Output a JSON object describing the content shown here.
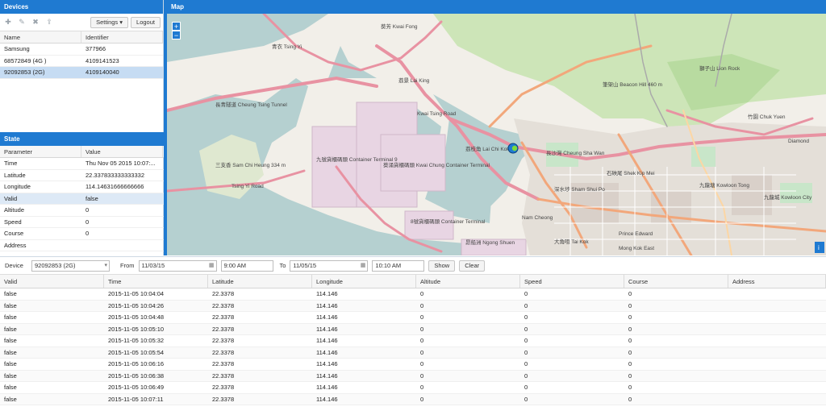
{
  "devices_panel": {
    "title": "Devices",
    "settings_label": "Settings",
    "logout_label": "Logout",
    "columns": [
      "Name",
      "Identifier"
    ],
    "rows": [
      {
        "name": "Samsung",
        "identifier": "377966"
      },
      {
        "name": "68572849 (4G )",
        "identifier": "4109141523"
      },
      {
        "name": "92092853 (2G)",
        "identifier": "4109140040"
      }
    ]
  },
  "state_panel": {
    "title": "State",
    "columns": [
      "Parameter",
      "Value"
    ],
    "rows": [
      {
        "param": "Time",
        "value": "Thu Nov 05 2015 10:07:..."
      },
      {
        "param": "Latitude",
        "value": "22.337833333333332"
      },
      {
        "param": "Longitude",
        "value": "114.14631666666666"
      },
      {
        "param": "Valid",
        "value": "false"
      },
      {
        "param": "Altitude",
        "value": "0"
      },
      {
        "param": "Speed",
        "value": "0"
      },
      {
        "param": "Course",
        "value": "0"
      },
      {
        "param": "Address",
        "value": ""
      }
    ]
  },
  "map": {
    "title": "Map",
    "zoom_in": "+",
    "zoom_out": "−",
    "labels": {
      "container_terminal_1": "九號貨櫃碼頭 Container Terminal 9",
      "container_terminal_2": "葵涌貨櫃碼頭 Kwai Chung Container Terminal",
      "container_terminal_3": "8號貨櫃碼頭 Container Terminal",
      "lai_king": "荔景 Lai King",
      "kwai_fong": "葵芳 Kwai Fong",
      "tsing_yi": "青衣 Tsing Yi",
      "lai_chi_kok": "荔枝角 Lai Chi Kok",
      "cheung_sha_wan": "長沙灣 Cheung Sha Wan",
      "sham_shui_po": "深水埗 Sham Shui Po",
      "shek_kip_mei": "石硤尾 Shek Kip Mei",
      "kowloon_tong": "九龍塘 Kowloon Tong",
      "kowloon_city": "九龍城 Kowloon City",
      "nam_cheong": "Nam Cheong",
      "tai_kok_tsui": "大角咀 Tai Kok",
      "prince_edward": "Prince Edward",
      "mong_kok_east": "Mong Kok East",
      "lion_rock": "獅子山 Lion Rock",
      "beacon_hill": "筆架山 Beacon Hill 460 m",
      "sam_chi_heung": "三支香 Sam Chi Heung 334 m",
      "chuk_yuen": "竹園 Chuk Yuen",
      "tsing_yi_road": "Tsing Yi Road",
      "cheung_tsing_tunnel": "長青隧道 Cheung Tsing Tunnel",
      "diamond": "Diamond",
      "ngong_shuen": "昂船洲 Ngong Shuen",
      "kwai_tsing_road": "Kwai Tsing Road"
    }
  },
  "filter_bar": {
    "device_label": "Device",
    "device_value": "92092853 (2G)",
    "from_label": "From",
    "from_date": "11/03/15",
    "from_time": "9:00 AM",
    "to_label": "To",
    "to_date": "11/05/15",
    "to_time": "10:10 AM",
    "show_label": "Show",
    "clear_label": "Clear"
  },
  "history": {
    "columns": [
      "Valid",
      "Time",
      "Latitude",
      "Longitude",
      "Altitude",
      "Speed",
      "Course",
      "Address"
    ],
    "rows": [
      [
        "false",
        "2015-11-05 10:04:04",
        "22.3378",
        "114.146",
        "0",
        "0",
        "0",
        ""
      ],
      [
        "false",
        "2015-11-05 10:04:26",
        "22.3378",
        "114.146",
        "0",
        "0",
        "0",
        ""
      ],
      [
        "false",
        "2015-11-05 10:04:48",
        "22.3378",
        "114.146",
        "0",
        "0",
        "0",
        ""
      ],
      [
        "false",
        "2015-11-05 10:05:10",
        "22.3378",
        "114.146",
        "0",
        "0",
        "0",
        ""
      ],
      [
        "false",
        "2015-11-05 10:05:32",
        "22.3378",
        "114.146",
        "0",
        "0",
        "0",
        ""
      ],
      [
        "false",
        "2015-11-05 10:05:54",
        "22.3378",
        "114.146",
        "0",
        "0",
        "0",
        ""
      ],
      [
        "false",
        "2015-11-05 10:06:16",
        "22.3378",
        "114.146",
        "0",
        "0",
        "0",
        ""
      ],
      [
        "false",
        "2015-11-05 10:06:38",
        "22.3378",
        "114.146",
        "0",
        "0",
        "0",
        ""
      ],
      [
        "false",
        "2015-11-05 10:06:49",
        "22.3378",
        "114.146",
        "0",
        "0",
        "0",
        ""
      ],
      [
        "false",
        "2015-11-05 10:07:11",
        "22.3378",
        "114.146",
        "0",
        "0",
        "0",
        ""
      ]
    ]
  },
  "colors": {
    "accent": "#1f7ad1",
    "selected_row": "#c6dcf3"
  }
}
